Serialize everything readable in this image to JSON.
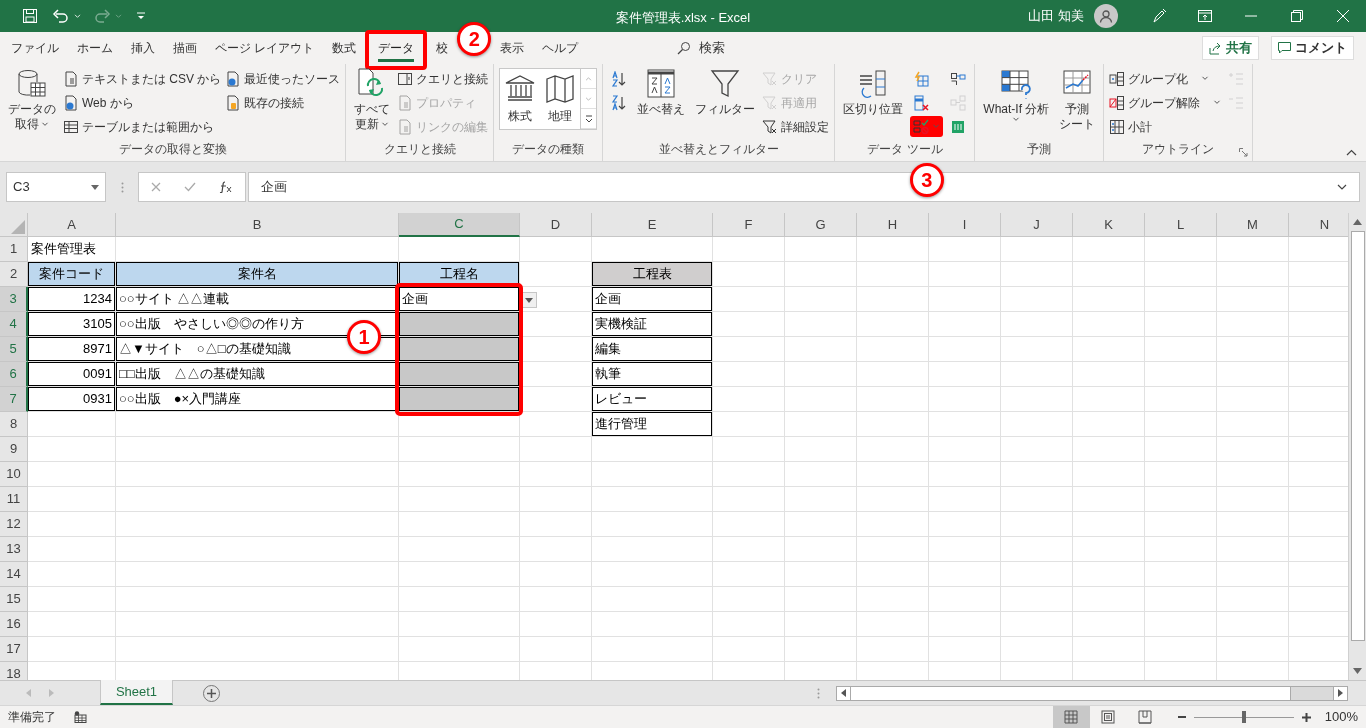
{
  "window": {
    "title": "案件管理表.xlsx  -  Excel",
    "user": "山田 知美"
  },
  "tabs": [
    {
      "label": "ファイル",
      "selected": false,
      "framed": false
    },
    {
      "label": "ホーム",
      "selected": false,
      "framed": false
    },
    {
      "label": "挿入",
      "selected": false,
      "framed": false
    },
    {
      "label": "描画",
      "selected": false,
      "framed": false
    },
    {
      "label": "ページ レイアウト",
      "selected": false,
      "framed": false
    },
    {
      "label": "数式",
      "selected": false,
      "framed": false
    },
    {
      "label": "データ",
      "selected": true,
      "framed": true
    },
    {
      "label": "校",
      "selected": false,
      "framed": false
    },
    {
      "label": "表示",
      "selected": false,
      "framed": false
    },
    {
      "label": "ヘルプ",
      "selected": false,
      "framed": false
    }
  ],
  "search": {
    "label": "検索"
  },
  "share_button": "共有",
  "comment_button": "コメント",
  "ribbon_groups": [
    {
      "label": "データの取得と変換",
      "columns": [
        [
          {
            "kind": "large",
            "label": [
              "データの",
              "取得"
            ],
            "caret": true
          }
        ],
        [
          {
            "kind": "small",
            "label": "テキストまたは CSV から"
          },
          {
            "kind": "small",
            "label": "Web から"
          },
          {
            "kind": "small",
            "label": "テーブルまたは範囲から"
          }
        ],
        [
          {
            "kind": "small",
            "label": "最近使ったソース"
          },
          {
            "kind": "small",
            "label": "既存の接続"
          }
        ]
      ]
    },
    {
      "label": "クエリと接続",
      "columns": [
        [
          {
            "kind": "large",
            "label": [
              "すべて",
              "更新"
            ],
            "caret": true
          }
        ],
        [
          {
            "kind": "small",
            "label": "クエリと接続",
            "disabled": false
          },
          {
            "kind": "small",
            "label": "プロパティ",
            "disabled": true
          },
          {
            "kind": "small",
            "label": "リンクの編集",
            "disabled": true
          }
        ]
      ]
    },
    {
      "label": "データの種類",
      "columns": [
        [
          {
            "kind": "gallery",
            "label": "株式"
          },
          {
            "kind": "gallery",
            "label": "地理"
          }
        ]
      ]
    },
    {
      "label": "並べ替えとフィルター",
      "columns": [
        [
          {
            "kind": "icon"
          },
          {
            "kind": "icon"
          }
        ],
        [
          {
            "kind": "large",
            "label": "並べ替え"
          }
        ],
        [
          {
            "kind": "large",
            "label": "フィルター"
          }
        ],
        [
          {
            "kind": "small",
            "label": "クリア",
            "disabled": true
          },
          {
            "kind": "small",
            "label": "再適用",
            "disabled": true
          },
          {
            "kind": "small",
            "label": "詳細設定",
            "disabled": false
          }
        ]
      ]
    },
    {
      "label": "データ ツール",
      "columns": [
        [
          {
            "kind": "large",
            "label": "区切り位置"
          }
        ],
        [
          {
            "kind": "icon"
          },
          {
            "kind": "icon"
          },
          {
            "kind": "icon",
            "framed": true,
            "caret": true
          }
        ],
        [
          {
            "kind": "icon",
            "disabled": false
          },
          {
            "kind": "icon",
            "disabled": true
          },
          {
            "kind": "icon",
            "disabled": false
          }
        ]
      ]
    },
    {
      "label": "予測",
      "columns": [
        [
          {
            "kind": "large",
            "label": "What-If 分析",
            "caret": true
          }
        ],
        [
          {
            "kind": "large",
            "label": [
              "予測",
              "シート"
            ]
          }
        ]
      ]
    },
    {
      "label": "アウトライン",
      "columns": [
        [
          {
            "kind": "small",
            "label": "グループ化",
            "caret": true
          },
          {
            "kind": "small",
            "label": "グループ解除",
            "caret": true
          },
          {
            "kind": "small",
            "label": "小計"
          }
        ],
        [
          {
            "kind": "icon",
            "disabled": true
          },
          {
            "kind": "icon",
            "disabled": true
          }
        ]
      ]
    }
  ],
  "formula_bar": {
    "name_box": "C3",
    "value": "企画"
  },
  "columns": [
    {
      "label": "A",
      "selected": false
    },
    {
      "label": "B",
      "selected": false
    },
    {
      "label": "C",
      "selected": true
    },
    {
      "label": "D",
      "selected": false
    },
    {
      "label": "E",
      "selected": false
    },
    {
      "label": "F",
      "selected": false
    },
    {
      "label": "G",
      "selected": false
    },
    {
      "label": "H",
      "selected": false
    },
    {
      "label": "I",
      "selected": false
    },
    {
      "label": "J",
      "selected": false
    },
    {
      "label": "K",
      "selected": false
    },
    {
      "label": "L",
      "selected": false
    },
    {
      "label": "M",
      "selected": false
    },
    {
      "label": "N",
      "selected": false
    }
  ],
  "rows": [
    {
      "header": "1",
      "selected": false,
      "cells": {
        "A": {
          "kind": "title",
          "text": "案件管理表"
        }
      }
    },
    {
      "header": "2",
      "selected": false,
      "cells": {
        "A": {
          "kind": "header",
          "text": "案件コード"
        },
        "B": {
          "kind": "header",
          "text": "案件名"
        },
        "C": {
          "kind": "header",
          "text": "工程名"
        },
        "E": {
          "kind": "list_header",
          "text": "工程表"
        }
      }
    },
    {
      "header": "3",
      "selected": true,
      "cells": {
        "A": {
          "kind": "number",
          "text": "1234"
        },
        "B": {
          "kind": "text",
          "text": "○○サイト △△連載"
        },
        "C": {
          "kind": "text",
          "text": "企画",
          "dropdown": true
        },
        "E": {
          "kind": "text",
          "text": "企画"
        }
      }
    },
    {
      "header": "4",
      "selected": true,
      "cells": {
        "A": {
          "kind": "number",
          "text": "3105"
        },
        "B": {
          "kind": "text",
          "text": "○○出版　やさしい◎◎の作り方"
        },
        "C": {
          "kind": "pending"
        },
        "E": {
          "kind": "text",
          "text": "実機検証"
        }
      }
    },
    {
      "header": "5",
      "selected": true,
      "cells": {
        "A": {
          "kind": "number",
          "text": "8971"
        },
        "B": {
          "kind": "text",
          "text": "△▼サイト　○△□の基礎知識"
        },
        "C": {
          "kind": "pending"
        },
        "E": {
          "kind": "text",
          "text": "編集"
        }
      }
    },
    {
      "header": "6",
      "selected": true,
      "cells": {
        "A": {
          "kind": "number",
          "text": "0091"
        },
        "B": {
          "kind": "text",
          "text": "□□出版　△△の基礎知識"
        },
        "C": {
          "kind": "pending"
        },
        "E": {
          "kind": "text",
          "text": "執筆"
        }
      }
    },
    {
      "header": "7",
      "selected": true,
      "cells": {
        "A": {
          "kind": "number",
          "text": "0931"
        },
        "B": {
          "kind": "text",
          "text": "○○出版　●×入門講座"
        },
        "C": {
          "kind": "pending"
        },
        "E": {
          "kind": "text",
          "text": "レビュー"
        }
      }
    },
    {
      "header": "8",
      "selected": false,
      "cells": {
        "E": {
          "kind": "text",
          "text": "進行管理"
        }
      }
    },
    {
      "header": "9",
      "selected": false
    },
    {
      "header": "10",
      "selected": false
    },
    {
      "header": "11",
      "selected": false
    },
    {
      "header": "12",
      "selected": false
    },
    {
      "header": "13",
      "selected": false
    },
    {
      "header": "14",
      "selected": false
    },
    {
      "header": "15",
      "selected": false
    },
    {
      "header": "16",
      "selected": false
    },
    {
      "header": "17",
      "selected": false
    },
    {
      "header": "18",
      "selected": false
    }
  ],
  "sheet_tabs": [
    {
      "label": "Sheet1",
      "selected": true
    }
  ],
  "status_bar": {
    "text": "準備完了",
    "views": [
      {
        "selected": true
      },
      {
        "selected": false
      },
      {
        "selected": false
      }
    ],
    "zoom": {
      "level": 0.5,
      "reading": "100%"
    }
  },
  "annotations": [
    {
      "kind": "badge",
      "label": "2"
    },
    {
      "kind": "badge",
      "label": "3"
    },
    {
      "kind": "frame"
    },
    {
      "kind": "badge",
      "label": "1"
    }
  ]
}
